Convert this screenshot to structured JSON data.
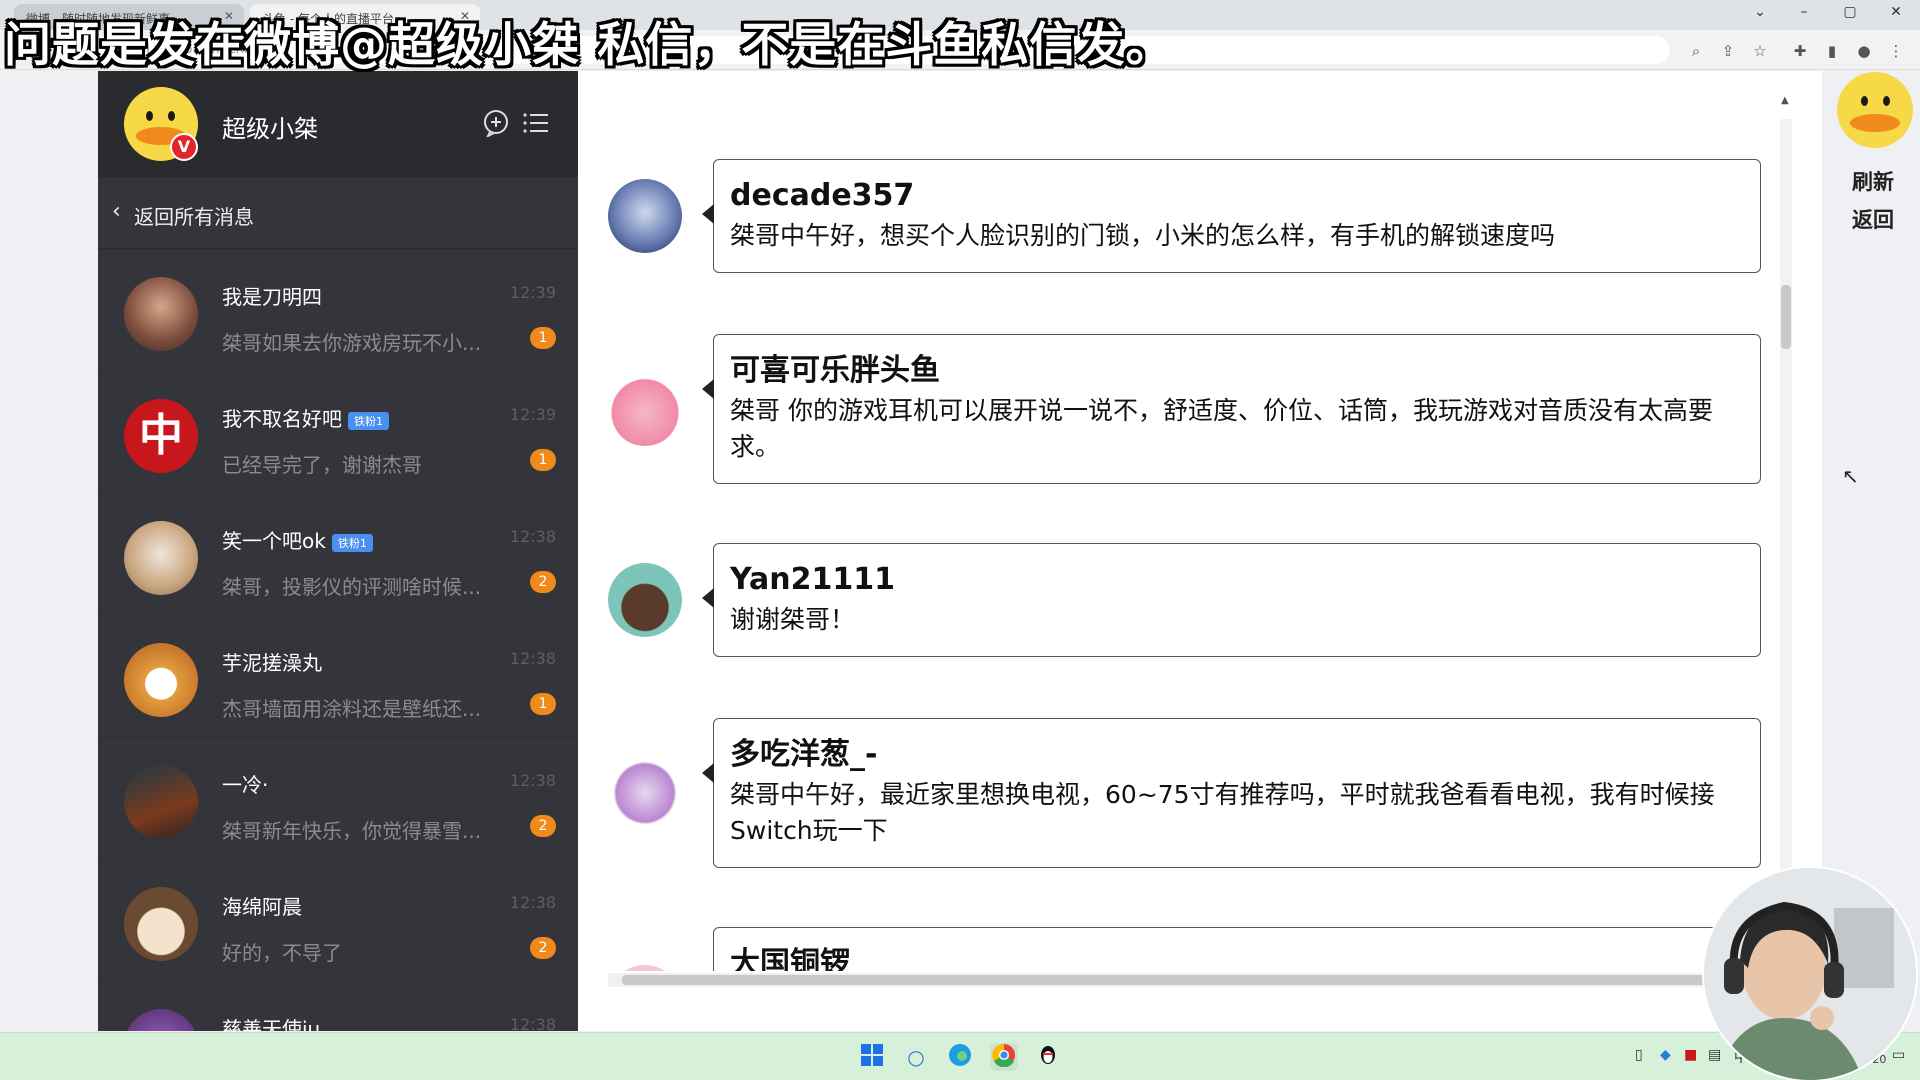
{
  "caption": "问题是发在微博@超级小桀 私信，不是在斗鱼私信发。",
  "browser": {
    "tabs": [
      "微博 - 随时随地发现新鲜事",
      "斗鱼 - 每个人的直播平台"
    ],
    "window_controls": [
      "⌄",
      "–",
      "▢",
      "✕"
    ],
    "address": "api.weibo.com/chat"
  },
  "colors": {
    "panel": "#34353a",
    "panel_head": "#2a2b2f",
    "badge": "#f08a1c",
    "taskbar": "#d6f0d9"
  },
  "profile": {
    "name": "超级小桀",
    "badge": "V"
  },
  "back_label": "返回所有消息",
  "conversations": [
    {
      "name": "我是刀明四",
      "fan": "",
      "time": "12:39",
      "preview": "桀哥如果去你游戏房玩不小...",
      "count": "1"
    },
    {
      "name": "我不取名好吧",
      "fan": "铁粉1",
      "time": "12:39",
      "preview": "已经导完了，谢谢杰哥",
      "count": "1"
    },
    {
      "name": "笑一个吧ok",
      "fan": "铁粉1",
      "time": "12:38",
      "preview": "桀哥，投影仪的评测啥时候...",
      "count": "2"
    },
    {
      "name": "芋泥搓澡丸",
      "fan": "",
      "time": "12:38",
      "preview": "杰哥墙面用涂料还是壁纸还...",
      "count": "1"
    },
    {
      "name": "一冷·",
      "fan": "",
      "time": "12:38",
      "preview": "桀哥新年快乐，你觉得暴雪...",
      "count": "2"
    },
    {
      "name": "海绵阿晨",
      "fan": "",
      "time": "12:38",
      "preview": "好的，不导了",
      "count": "2"
    },
    {
      "name": "慈善天使iu",
      "fan": "",
      "time": "12:38",
      "preview": "",
      "count": ""
    }
  ],
  "messages": [
    {
      "sender": "decade357",
      "text": "桀哥中午好，想买个人脸识别的门锁，小米的怎么样，有手机的解锁速度吗"
    },
    {
      "sender": "可喜可乐胖头鱼",
      "text": "桀哥 你的游戏耳机可以展开说一说不，舒适度、价位、话筒，我玩游戏对音质没有太高要求。"
    },
    {
      "sender": "Yan21111",
      "text": "谢谢桀哥！"
    },
    {
      "sender": "多吃洋葱_-",
      "text": "桀哥中午好，最近家里想换电视，60~75寸有推荐吗，平时就我爸看看电视，我有时候接Switch玩一下"
    },
    {
      "sender": "大国铜锣",
      "text": ""
    }
  ],
  "side": {
    "refresh": "刷新",
    "back": "返回"
  },
  "taskbar": {
    "tray_lang": "中",
    "date": "2023/1/20"
  }
}
